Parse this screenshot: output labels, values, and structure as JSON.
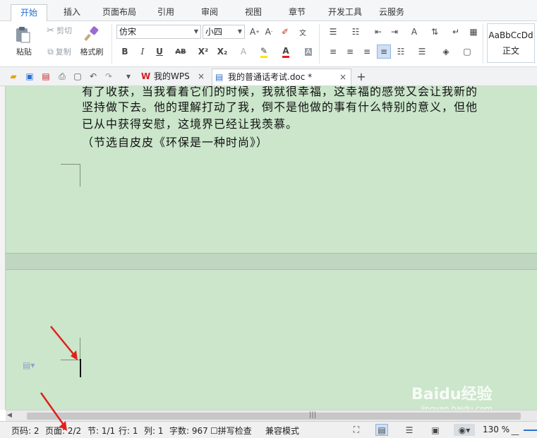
{
  "ribbon_tabs": [
    "开始",
    "插入",
    "页面布局",
    "引用",
    "审阅",
    "视图",
    "章节",
    "开发工具",
    "云服务"
  ],
  "clipboard": {
    "cut": "剪切",
    "copy": "复制",
    "paste": "粘贴",
    "format_painter": "格式刷"
  },
  "font": {
    "name": "仿宋",
    "size": "小四"
  },
  "format_buttons": {
    "bold": "B",
    "italic": "I",
    "underline": "U",
    "strikethrough": "AB",
    "superscript": "X²",
    "subscript": "X₂"
  },
  "style_preview": {
    "sample": "AaBbCcDd",
    "name": "正文"
  },
  "doc_tabs": [
    {
      "label": "我的WPS",
      "active": false
    },
    {
      "label": "我的普通话考试.doc *",
      "active": true
    }
  ],
  "new_tab_symbol": "+",
  "document": {
    "lines": [
      "有了收获，当我看着它们的时候，我就很幸福，这幸福的感觉又会让我新的",
      "坚持做下去。他的理解打动了我，倒不是他做的事有什么特别的意义，但他",
      "已从中获得安慰，这境界已经让我羡慕。",
      "（节选自皮皮《环保是一种时尚》）"
    ]
  },
  "status": {
    "page_code": "页码: 2",
    "pages": "页面: 2/2",
    "section": "节: 1/1",
    "row": "行: 1",
    "col": "列: 1",
    "word_count": "字数: 967",
    "spell_check": "拼写检查",
    "compat_mode": "兼容模式",
    "zoom": "130 %"
  },
  "watermark": {
    "brand": "Baidu经验",
    "url": "jingyan.baidu.com"
  },
  "colors": {
    "accent": "#1e6fd0",
    "doc_background": "#cbe6cb",
    "annotation": "#e0201c"
  }
}
